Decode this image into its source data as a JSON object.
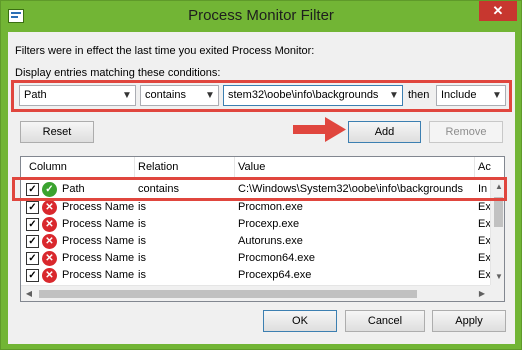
{
  "window": {
    "title": "Process Monitor Filter",
    "close_label": "✕"
  },
  "info_text": "Filters were in effect the last time you exited Process Monitor:",
  "conditions_text": "Display entries matching these conditions:",
  "condition_row": {
    "column_value": "Path",
    "relation_value": "contains",
    "value_text": "stem32\\oobe\\info\\backgrounds",
    "then_label": "then",
    "action_value": "Include"
  },
  "buttons": {
    "reset": "Reset",
    "add": "Add",
    "remove": "Remove",
    "ok": "OK",
    "cancel": "Cancel",
    "apply": "Apply"
  },
  "table": {
    "headers": [
      "Column",
      "Relation",
      "Value",
      "Ac"
    ],
    "rows": [
      {
        "checked": true,
        "status": "include",
        "column": "Path",
        "relation": "contains",
        "value": "C:\\Windows\\System32\\oobe\\info\\backgrounds",
        "action": "In"
      },
      {
        "checked": true,
        "status": "exclude",
        "column": "Process Name",
        "relation": "is",
        "value": "Procmon.exe",
        "action": "Ex"
      },
      {
        "checked": true,
        "status": "exclude",
        "column": "Process Name",
        "relation": "is",
        "value": "Procexp.exe",
        "action": "Ex"
      },
      {
        "checked": true,
        "status": "exclude",
        "column": "Process Name",
        "relation": "is",
        "value": "Autoruns.exe",
        "action": "Ex"
      },
      {
        "checked": true,
        "status": "exclude",
        "column": "Process Name",
        "relation": "is",
        "value": "Procmon64.exe",
        "action": "Ex"
      },
      {
        "checked": true,
        "status": "exclude",
        "column": "Process Name",
        "relation": "is",
        "value": "Procexp64.exe",
        "action": "Ex"
      }
    ]
  },
  "colors": {
    "window_frame": "#72b535",
    "highlight": "#e0463e",
    "include_icon": "#3aa32f",
    "exclude_icon": "#d9282d"
  },
  "icons": {
    "checkmark": "✓",
    "include": "check-circle-icon",
    "exclude": "x-circle-icon"
  }
}
